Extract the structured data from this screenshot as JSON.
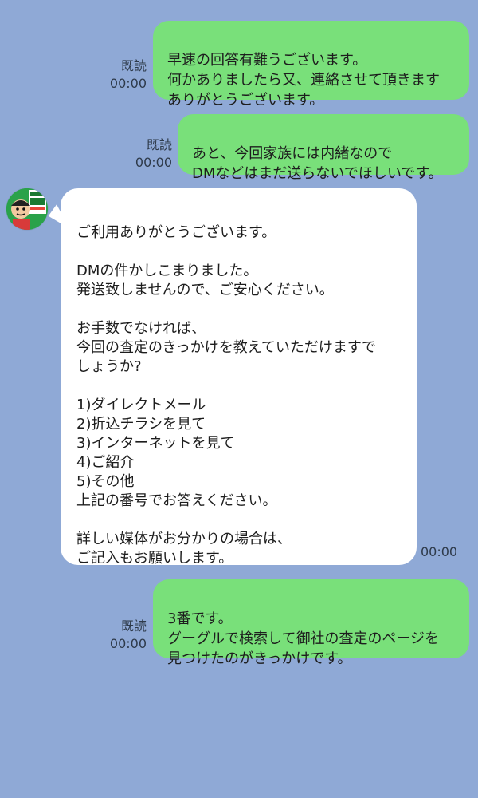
{
  "colors": {
    "background": "#8fa9d6",
    "sent_bubble": "#79e07a",
    "received_bubble": "#ffffff",
    "meta_text": "#2e3a4a"
  },
  "messages": [
    {
      "direction": "sent",
      "text": "早速の回答有難うございます。\n何かありましたら又、連絡させて頂きます\nありがとうございます。",
      "read_label": "既読",
      "time": "00:00"
    },
    {
      "direction": "sent",
      "text": "あと、今回家族には内緒なので\nDMなどはまだ送らないでほしいです。",
      "read_label": "既読",
      "time": "00:00"
    },
    {
      "direction": "received",
      "avatar_icon": "real-estate-appraisal-avatar-icon",
      "text": "ご利用ありがとうございます。\n\nDMの件かしこまりました。\n発送致しませんので、ご安心ください。\n\nお手数でなければ、\n今回の査定のきっかけを教えていただけますで\nしょうか?\n\n1)ダイレクトメール\n2)折込チラシを見て\n3)インターネットを見て\n4)ご紹介\n5)その他\n上記の番号でお答えください。\n\n詳しい媒体がお分かりの場合は、\nご記入もお願いします。",
      "time": "00:00"
    },
    {
      "direction": "sent",
      "text": "3番です。\nグーグルで検索して御社の査定のページを\n見つけたのがきっかけです。",
      "read_label": "既読",
      "time": "00:00"
    }
  ]
}
